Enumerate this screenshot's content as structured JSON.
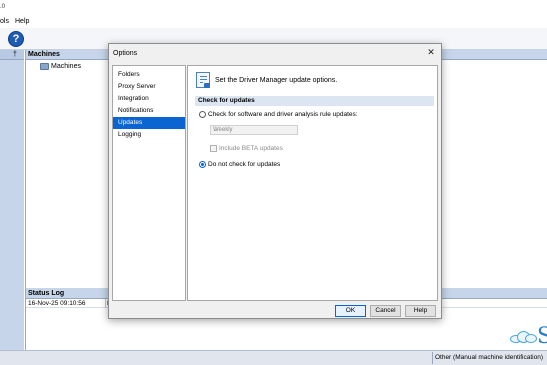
{
  "app": {
    "title_fragment": ".0",
    "menu": {
      "tools_fragment": "ols",
      "help": "Help"
    },
    "toolbar": {
      "help_icon": "?",
      "pin_glyph": "†"
    },
    "machines_panel": {
      "header": "Machines",
      "tree_root": "Machines"
    },
    "status_log": {
      "header": "Status Log",
      "rows": [
        {
          "timestamp": "16-Nov-25 09:10:56",
          "message": "L"
        }
      ]
    },
    "logo_letter": "S",
    "statusbar": {
      "text": "Other (Manual machine identification)"
    }
  },
  "dialog": {
    "title": "Options",
    "close_glyph": "✕",
    "nav": [
      {
        "label": "Folders",
        "selected": false
      },
      {
        "label": "Proxy Server",
        "selected": false
      },
      {
        "label": "Integration",
        "selected": false
      },
      {
        "label": "Notifications",
        "selected": false
      },
      {
        "label": "Updates",
        "selected": true
      },
      {
        "label": "Logging",
        "selected": false
      }
    ],
    "page": {
      "header_text": "Set the Driver Manager update options.",
      "section_title": "Check for updates",
      "option_check": {
        "label": "Check for software and driver analysis rule updates:",
        "checked": false
      },
      "frequency": {
        "value": "Weekly",
        "enabled": false
      },
      "include_beta": {
        "label": "Include BETA updates",
        "checked": false,
        "enabled": false
      },
      "option_no_check": {
        "label": "Do not check for updates",
        "checked": true
      }
    },
    "buttons": {
      "ok": "OK",
      "cancel": "Cancel",
      "help": "Help"
    }
  },
  "colors": {
    "selection": "#0a64d2",
    "panel_header": "#c6d5ea",
    "section_band": "#dce6f3"
  }
}
